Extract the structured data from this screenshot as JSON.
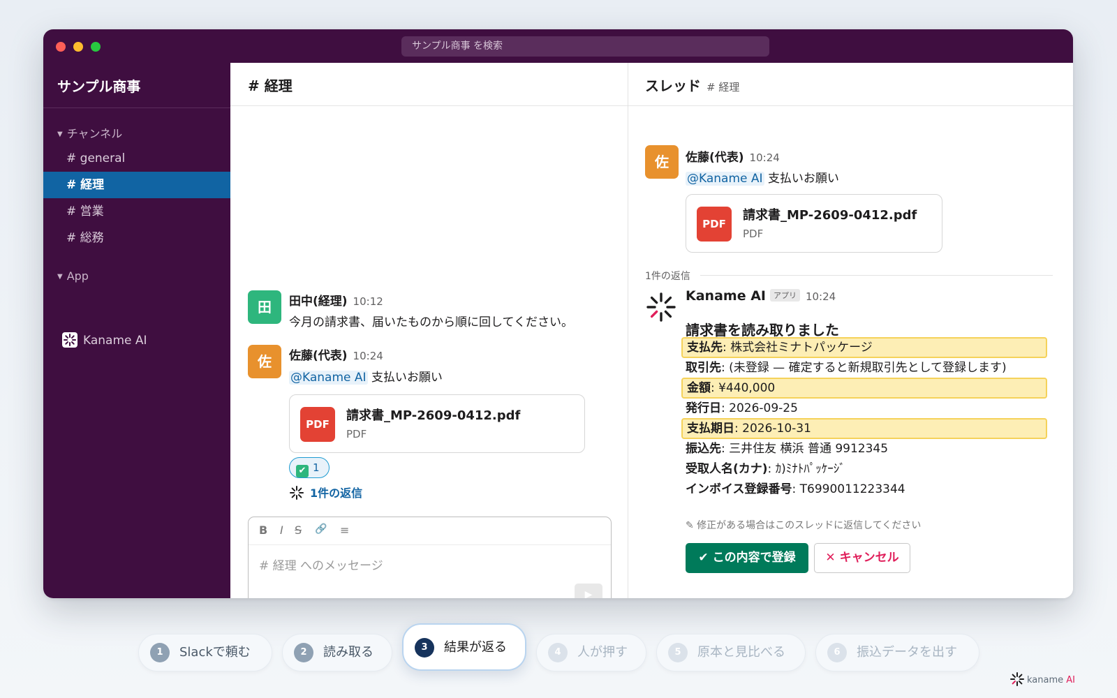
{
  "search": {
    "placeholder": "サンプル商事 を検索"
  },
  "sidebar": {
    "workspace": "サンプル商事",
    "channels_header": "チャンネル",
    "channels": [
      "# general",
      "# 経理",
      "# 営業",
      "# 総務"
    ],
    "active_channel_index": 1,
    "apps_header": "App",
    "apps": [
      "Kaname AI"
    ]
  },
  "channel": {
    "title": "# 経理",
    "messages": [
      {
        "avatar": "田",
        "name": "田中(経理)",
        "time": "10:12",
        "text": "今月の請求書、届いたものから順に回してください。"
      },
      {
        "avatar": "佐",
        "name": "佐藤(代表)",
        "time": "10:24",
        "mention": "@Kaname AI",
        "text": "支払いお願い"
      }
    ],
    "file": {
      "name": "請求書_MP-2609-0412.pdf",
      "type": "PDF",
      "badge": "PDF"
    },
    "reaction": {
      "emoji": "✔",
      "count": "1"
    },
    "reply_link": "1件の返信",
    "composer": {
      "bold": "B",
      "italic": "I",
      "strike": "S",
      "link": "🔗",
      "list": "≡",
      "placeholder": "# 経理 へのメッセージ",
      "send": "▶"
    }
  },
  "thread": {
    "title": "スレッド",
    "subtitle": "# 経理",
    "parent": {
      "avatar": "佐",
      "name": "佐藤(代表)",
      "time": "10:24",
      "mention": "@Kaname AI",
      "text": "支払いお願い"
    },
    "file": {
      "name": "請求書_MP-2609-0412.pdf",
      "type": "PDF",
      "badge": "PDF"
    },
    "replies_count": "1件の返信",
    "bot": {
      "name": "Kaname AI",
      "tag": "アプリ",
      "time": "10:24",
      "title": "請求書を読み取りました",
      "fields": [
        {
          "label": "支払先",
          "value": ": 株式会社ミナトパッケージ",
          "highlight": true
        },
        {
          "label": "取引先",
          "value": ": (未登録 — 確定すると新規取引先として登録します)",
          "highlight": false
        },
        {
          "label": "金額",
          "value": ": ¥440,000",
          "highlight": true
        },
        {
          "label": "発行日",
          "value": ": 2026-09-25",
          "highlight": false
        },
        {
          "label": "支払期日",
          "value": ": 2026-10-31",
          "highlight": true
        },
        {
          "label": "振込先",
          "value": ": 三井住友 横浜 普通 9912345",
          "highlight": false
        },
        {
          "label": "受取人名(カナ)",
          "value": ": ｶ)ﾐﾅﾄﾊﾟｯｹｰｼﾞ",
          "highlight": false
        },
        {
          "label": "インボイス登録番号",
          "value": ": T6990011223344",
          "highlight": false
        }
      ],
      "note": "✎ 修正がある場合はこのスレッドに返信してください",
      "confirm_label": "✔ この内容で登録",
      "cancel_label": "✕ キャンセル"
    }
  },
  "steps": [
    {
      "num": "1",
      "label": "Slackで頼む",
      "state": "done"
    },
    {
      "num": "2",
      "label": "読み取る",
      "state": "done"
    },
    {
      "num": "3",
      "label": "結果が返る",
      "state": "active"
    },
    {
      "num": "4",
      "label": "人が押す",
      "state": "future"
    },
    {
      "num": "5",
      "label": "原本と見比べる",
      "state": "future"
    },
    {
      "num": "6",
      "label": "振込データを出す",
      "state": "future"
    }
  ],
  "brand": {
    "kaname": "kaname",
    "ai": "AI"
  },
  "colors": {
    "sidebar_bg": "#3f0e40",
    "active_channel": "#1164a3",
    "mention": "#1264a3",
    "highlight": "#fdeeb5",
    "confirm": "#007a5a",
    "cancel": "#e01e5a",
    "pdf": "#e34234"
  }
}
